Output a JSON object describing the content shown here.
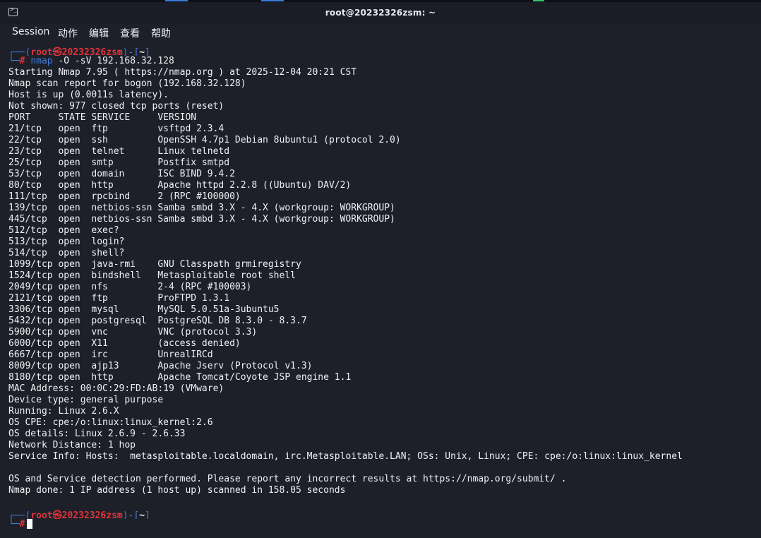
{
  "window": {
    "title": "root@20232326zsm: ~"
  },
  "colors": {
    "background": "#1e2029",
    "prompt_blue": "#3f7bd9",
    "prompt_red": "#e2333a",
    "text": "#eef0f4"
  },
  "icons": {
    "terminal": "terminal-icon"
  },
  "menu": {
    "items": [
      "Session",
      "动作",
      "编辑",
      "查看",
      "帮助"
    ]
  },
  "prompt": {
    "user": "root",
    "at": "㉿",
    "host": "20232326zsm",
    "dir": "~",
    "symbol": "#"
  },
  "command": {
    "name": "nmap",
    "args": " -O -sV 192.168.32.128"
  },
  "output": [
    "Starting Nmap 7.95 ( https://nmap.org ) at 2025-12-04 20:21 CST",
    "Nmap scan report for bogon (192.168.32.128)",
    "Host is up (0.0011s latency).",
    "Not shown: 977 closed tcp ports (reset)",
    "PORT     STATE SERVICE     VERSION",
    "21/tcp   open  ftp         vsftpd 2.3.4",
    "22/tcp   open  ssh         OpenSSH 4.7p1 Debian 8ubuntu1 (protocol 2.0)",
    "23/tcp   open  telnet      Linux telnetd",
    "25/tcp   open  smtp        Postfix smtpd",
    "53/tcp   open  domain      ISC BIND 9.4.2",
    "80/tcp   open  http        Apache httpd 2.2.8 ((Ubuntu) DAV/2)",
    "111/tcp  open  rpcbind     2 (RPC #100000)",
    "139/tcp  open  netbios-ssn Samba smbd 3.X - 4.X (workgroup: WORKGROUP)",
    "445/tcp  open  netbios-ssn Samba smbd 3.X - 4.X (workgroup: WORKGROUP)",
    "512/tcp  open  exec?",
    "513/tcp  open  login?",
    "514/tcp  open  shell?",
    "1099/tcp open  java-rmi    GNU Classpath grmiregistry",
    "1524/tcp open  bindshell   Metasploitable root shell",
    "2049/tcp open  nfs         2-4 (RPC #100003)",
    "2121/tcp open  ftp         ProFTPD 1.3.1",
    "3306/tcp open  mysql       MySQL 5.0.51a-3ubuntu5",
    "5432/tcp open  postgresql  PostgreSQL DB 8.3.0 - 8.3.7",
    "5900/tcp open  vnc         VNC (protocol 3.3)",
    "6000/tcp open  X11         (access denied)",
    "6667/tcp open  irc         UnrealIRCd",
    "8009/tcp open  ajp13       Apache Jserv (Protocol v1.3)",
    "8180/tcp open  http        Apache Tomcat/Coyote JSP engine 1.1",
    "MAC Address: 00:0C:29:FD:AB:19 (VMware)",
    "Device type: general purpose",
    "Running: Linux 2.6.X",
    "OS CPE: cpe:/o:linux:linux_kernel:2.6",
    "OS details: Linux 2.6.9 - 2.6.33",
    "Network Distance: 1 hop",
    "Service Info: Hosts:  metasploitable.localdomain, irc.Metasploitable.LAN; OSs: Unix, Linux; CPE: cpe:/o:linux:linux_kernel",
    "",
    "OS and Service detection performed. Please report any incorrect results at https://nmap.org/submit/ .",
    "Nmap done: 1 IP address (1 host up) scanned in 158.05 seconds",
    ""
  ]
}
